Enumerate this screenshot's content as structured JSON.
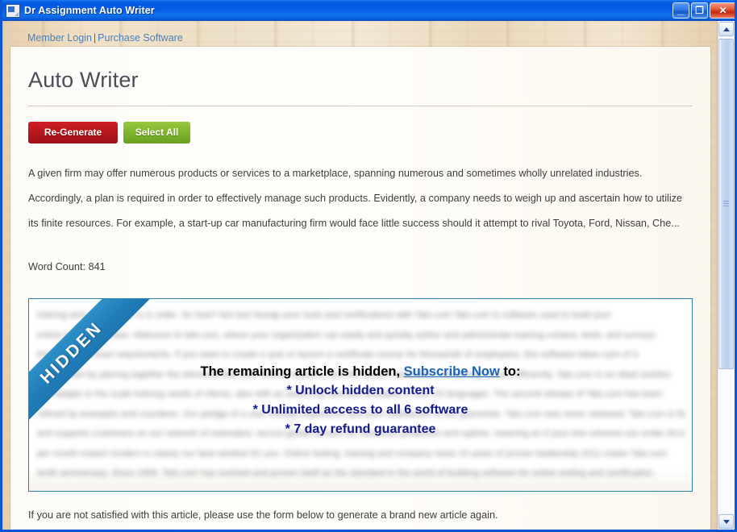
{
  "window": {
    "title": "Dr Assignment Auto Writer",
    "icon": "document-app-icon",
    "controls": {
      "minimize": "_",
      "maximize": "❐",
      "close": "✕"
    }
  },
  "topnav": {
    "member_login": "Member Login",
    "separator": "|",
    "purchase_software": "Purchase Software"
  },
  "page": {
    "title": "Auto Writer",
    "buttons": {
      "regenerate": "Re-Generate",
      "select_all": "Select All"
    },
    "preview_text": "A given firm may offer numerous products or services to a marketplace, spanning numerous and sometimes wholly unrelated industries. Accordingly, a plan is required in order to effectively manage such products. Evidently, a company needs to weigh up and ascertain how to utilize its finite resources. For example, a start-up car manufacturing firm would face little success should it attempt to rival Toyota, Ford, Nissan, Che...",
    "word_count_label": "Word Count: 841",
    "footer_note": "If you are not satisfied with this article, please use the form below to generate a brand new article again."
  },
  "hidden_box": {
    "ribbon_label": "HIDDEN",
    "overlay": {
      "line1_before": "The remaining article is hidden, ",
      "link": "Subscribe Now",
      "line1_after": " to:",
      "bullet1": "* Unlock hidden content",
      "bullet2": "* Unlimited access to all 6 software",
      "bullet3": "* 7 day refund guarantee"
    },
    "blurred_lines": [
      "training and certification is in order. So how? Not text Nooap your tools and certifications with Talo.com Talo.com is software used to build your",
      "online training courses. Welcome to talo.com, where your organisation can easily and quickly author and administrate training content, tests, and surveys",
      "that suit your exact requirements. If you want to create a quiz or launch a certificate course for thousands of employees, this software takes care of it.",
      "Simply start by piecing together the elements that your course requires, and the system assembles everything for you efficiently. Talo.com is an ideal solution",
      "that adapts to the scale training needs of clients, also with an authoring interface available in over 20 languages. The second release of Talo.com has been",
      "refined by examples and countless. Our pledge of a user friendly experience and your satisfaction is our guarantee. Talo.com was never released: Talo.com is flexible",
      "and supports customers on our network of redundant, secure global servers for maximum protection and uptime, meaning an if your test volumes are under 50,000 tests",
      "per month instant renders is clearly our best window for you. Online testing, training and company news 10 years of proven leadership 2011 marks Talo.com",
      "tenth anniversary. Since 1996, Talo.com has evolved and proven itself as the standard in the world of building software for online testing and certification."
    ]
  },
  "scrollbar": {
    "up_arrow": "scroll-up",
    "down_arrow": "scroll-down"
  },
  "colors": {
    "titlebar": "#0a5ee6",
    "regenerate_button": "#b4161c",
    "select_all_button": "#7eb32c",
    "ribbon": "#2380bc",
    "box_border": "#2a7fa8",
    "link": "#1863b8",
    "bullet_text": "#141a8c"
  }
}
